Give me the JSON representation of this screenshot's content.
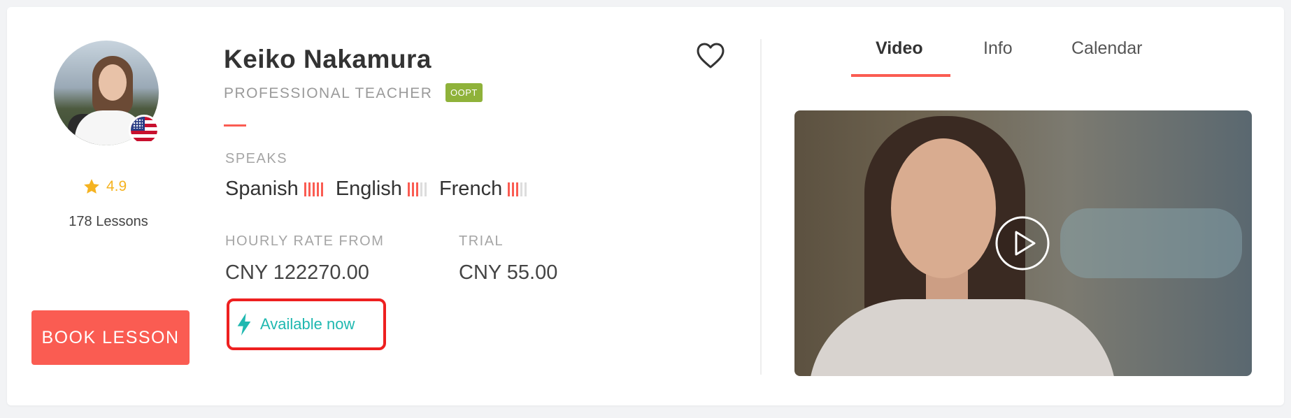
{
  "teacher": {
    "name": "Keiko Nakamura",
    "title": "PROFESSIONAL TEACHER",
    "badge": "OOPT",
    "rating": "4.9",
    "lessons": "178 Lessons",
    "avatar_icon": "teacher-avatar",
    "flag_icon": "us-flag-icon"
  },
  "speaks": {
    "label": "SPEAKS",
    "languages": [
      {
        "name": "Spanish",
        "level": 5,
        "max": 5
      },
      {
        "name": "English",
        "level": 3,
        "max": 5
      },
      {
        "name": "French",
        "level": 3,
        "max": 5
      }
    ]
  },
  "pricing": {
    "hourly_label": "HOURLY RATE FROM",
    "hourly_value": "CNY 122270.00",
    "trial_label": "TRIAL",
    "trial_value": "CNY 55.00"
  },
  "availability": {
    "text": "Available now",
    "icon": "lightning-icon",
    "color": "#1fb8b0",
    "highlight_color": "#ee2020"
  },
  "actions": {
    "book_label": "BOOK LESSON",
    "favorite_icon": "heart-icon",
    "play_icon": "play-icon"
  },
  "tabs": [
    {
      "label": "Video",
      "active": true
    },
    {
      "label": "Info",
      "active": false
    },
    {
      "label": "Calendar",
      "active": false
    }
  ],
  "colors": {
    "accent": "#fa5c52",
    "rating": "#f5b321",
    "badge": "#8fb23a"
  }
}
